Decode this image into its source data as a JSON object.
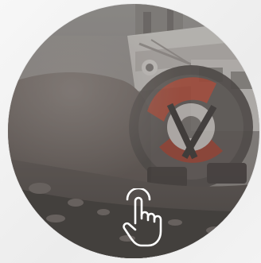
{
  "card": {
    "image_subject": "bucket-wheel-excavator-mining-photo",
    "overlay_tint": "#5e5a57",
    "accent_color": "#b2432f"
  },
  "interaction_hint": {
    "icon": "tap-hand-icon",
    "color": "#ffffff"
  }
}
